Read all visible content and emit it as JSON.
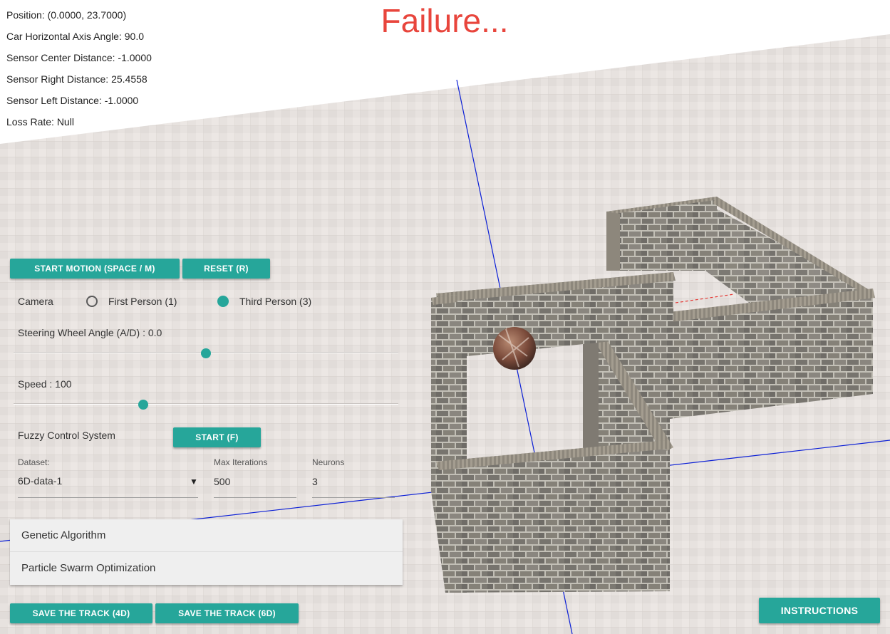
{
  "status": {
    "title": "Failure..."
  },
  "hud": {
    "position": "Position: (0.0000, 23.7000)",
    "angle": "Car Horizontal Axis Angle: 90.0",
    "sensor_center": "Sensor Center Distance: -1.0000",
    "sensor_right": "Sensor Right Distance: 25.4558",
    "sensor_left": "Sensor Left Distance: -1.0000",
    "loss_rate": "Loss Rate: Null"
  },
  "controls": {
    "start_motion": "START MOTION (SPACE / M)",
    "reset": "RESET (R)",
    "camera_label": "Camera",
    "first_person": "First Person (1)",
    "third_person": "Third Person (3)",
    "camera_selected": "third",
    "steering_label": "Steering Wheel Angle (A/D) : 0.0",
    "steering_value": 0.0,
    "speed_label": "Speed : 100",
    "speed_value": 100,
    "fuzzy_label": "Fuzzy Control System",
    "fuzzy_start": "START (F)"
  },
  "training": {
    "dataset_label": "Dataset:",
    "dataset_value": "6D-data-1",
    "max_iter_label": "Max Iterations",
    "max_iter_value": "500",
    "neurons_label": "Neurons",
    "neurons_value": "3"
  },
  "algorithms": [
    "Genetic Algorithm",
    "Particle Swarm Optimization"
  ],
  "save": {
    "save_4d": "SAVE THE TRACK (4D)",
    "save_6d": "SAVE THE TRACK (6D)"
  },
  "instructions": "INSTRUCTIONS",
  "colors": {
    "accent": "#26a69a",
    "failure": "#e8453c",
    "axis": "#0b1fd6",
    "sensor_ray": "#e53935"
  }
}
